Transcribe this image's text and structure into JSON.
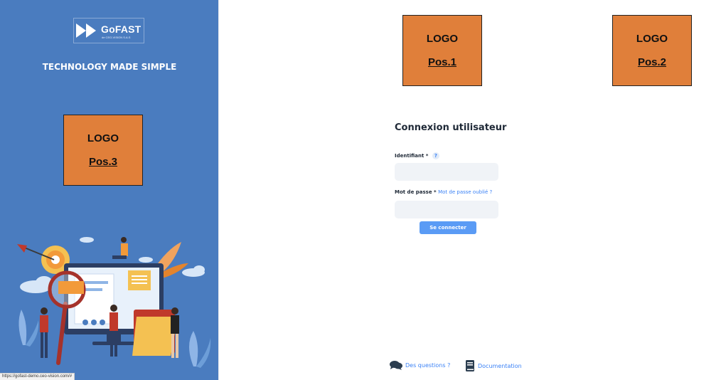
{
  "brand": {
    "name": "GoFAST",
    "subtitle": "de CEO-VISION S.A.S",
    "tagline": "TECHNOLOGY MADE SIMPLE"
  },
  "logos": [
    {
      "line1": "LOGO",
      "line2": "Pos.1"
    },
    {
      "line1": "LOGO",
      "line2": "Pos.2"
    },
    {
      "line1": "LOGO",
      "line2": "Pos.3"
    }
  ],
  "login": {
    "title": "Connexion utilisateur",
    "identifier_label": "Identifiant *",
    "identifier_help": "?",
    "identifier_value": "",
    "password_label": "Mot de passe *",
    "forgot_password": "Mot de passe oublié ?",
    "password_value": "",
    "submit_label": "Se connecter"
  },
  "footer": {
    "questions_label": "Des questions ?",
    "documentation_label": "Documentation"
  },
  "status_bar": {
    "url": "https://gofast-demo.ceo-vision.com/#"
  },
  "colors": {
    "sidebar_bg": "#4a7cbf",
    "logo_placeholder": "#e07f3a",
    "accent": "#3b82f6",
    "button": "#5a9bf5",
    "input_bg": "#f0f3f7"
  },
  "icons": {
    "brand": "gofast-double-arrow-logo",
    "questions": "chat-bubbles-icon",
    "documentation": "book-icon"
  }
}
